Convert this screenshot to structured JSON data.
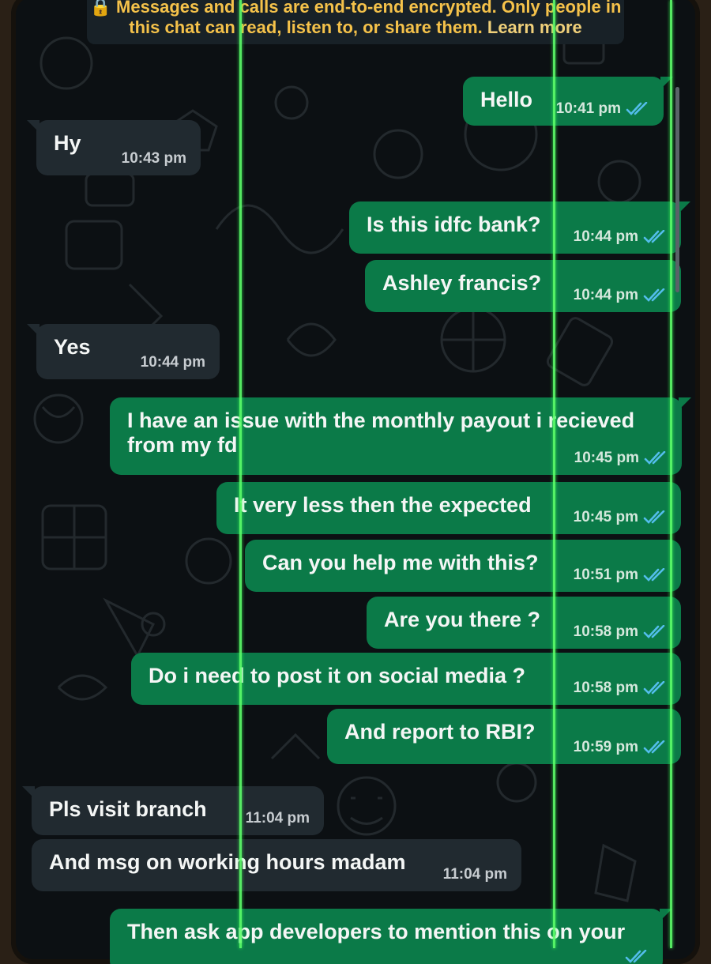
{
  "encryption_notice": {
    "text": "Messages and calls are end-to-end encrypted. Only people in this chat can read, listen to, or share them.",
    "link": "Learn more"
  },
  "messages": [
    {
      "dir": "out",
      "text": "Hello",
      "time": "10:41 pm",
      "status": "read"
    },
    {
      "dir": "in",
      "text": "Hy",
      "time": "10:43 pm"
    },
    {
      "dir": "out",
      "text": "Is this idfc bank?",
      "time": "10:44 pm",
      "status": "read"
    },
    {
      "dir": "out",
      "text": "Ashley francis?",
      "time": "10:44 pm",
      "status": "read"
    },
    {
      "dir": "in",
      "text": "Yes",
      "time": "10:44 pm"
    },
    {
      "dir": "out",
      "text": "I have an issue with the monthly payout i recieved from my fd",
      "time": "10:45 pm",
      "status": "read"
    },
    {
      "dir": "out",
      "text": "It very less then the expected",
      "time": "10:45 pm",
      "status": "read"
    },
    {
      "dir": "out",
      "text": "Can you help me with this?",
      "time": "10:51 pm",
      "status": "read"
    },
    {
      "dir": "out",
      "text": "Are you there ?",
      "time": "10:58 pm",
      "status": "read"
    },
    {
      "dir": "out",
      "text": "Do i need to post it on social media ?",
      "time": "10:58 pm",
      "status": "read"
    },
    {
      "dir": "out",
      "text": "And report to RBI?",
      "time": "10:59 pm",
      "status": "read"
    },
    {
      "dir": "in",
      "text": "Pls visit branch",
      "time": "11:04 pm"
    },
    {
      "dir": "in",
      "text": "And msg on working hours madam",
      "time": "11:04 pm"
    },
    {
      "dir": "out",
      "text": "Then ask app developers to mention this on your",
      "time": "",
      "status": "read"
    }
  ],
  "colors": {
    "outgoing_bubble": "#0b7a48",
    "incoming_bubble": "#212a30",
    "read_ticks": "#53bdeb",
    "banner_text": "#f5c24a"
  }
}
